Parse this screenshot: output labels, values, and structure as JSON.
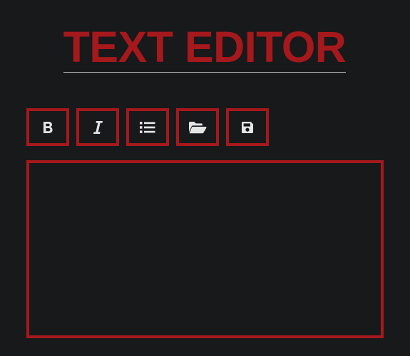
{
  "header": {
    "title": "TEXT EDITOR"
  },
  "toolbar": {
    "buttons": [
      {
        "id": "bold",
        "icon": "bold-icon"
      },
      {
        "id": "italic",
        "icon": "italic-icon"
      },
      {
        "id": "list",
        "icon": "list-icon"
      },
      {
        "id": "open",
        "icon": "folder-open-icon"
      },
      {
        "id": "save",
        "icon": "save-icon"
      }
    ]
  },
  "editor": {
    "value": "",
    "placeholder": ""
  },
  "colors": {
    "background": "#18191b",
    "accent": "#a5191c",
    "icon": "#e4e4e4",
    "rule": "#b9b9b9"
  }
}
